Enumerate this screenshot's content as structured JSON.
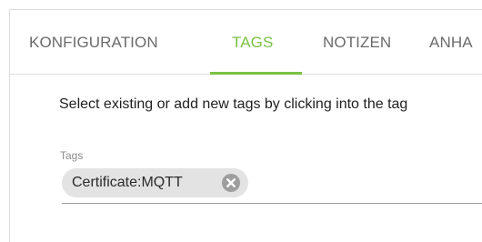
{
  "tabs": [
    {
      "label": "KONFIGURATION"
    },
    {
      "label": "TAGS"
    },
    {
      "label": "NOTIZEN"
    },
    {
      "label": "ANHA"
    }
  ],
  "active_tab": "TAGS",
  "tags_panel": {
    "instruction": "Select existing or add new tags by clicking into the tag",
    "field_label": "Tags",
    "chips": [
      {
        "label": "Certificate:MQTT"
      }
    ]
  },
  "colors": {
    "accent": "#7ac143",
    "tab_text": "#6b6b6b",
    "chip_bg": "#e3e3e3",
    "chip_remove_bg": "#9e9e9e"
  },
  "icons": {
    "chip_remove": "close-circle-icon"
  }
}
